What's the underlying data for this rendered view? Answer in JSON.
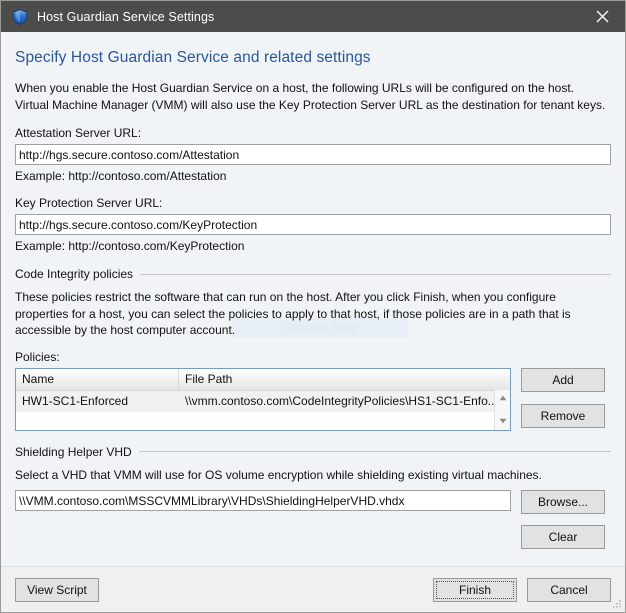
{
  "window": {
    "title": "Host Guardian Service Settings",
    "icon": "shield-icon",
    "close_label": "✕",
    "titlebar_color": "#4c4c4a",
    "body_color": "#f0f4f7",
    "accent_color": "#2b5797"
  },
  "page": {
    "heading": "Specify Host Guardian Service and related settings",
    "intro_line1": "When you enable the Host Guardian Service on a host, the following URLs will be configured on the host.",
    "intro_line2": "Virtual Machine Manager (VMM) will also use the Key Protection Server URL as the destination for tenant keys."
  },
  "attestation": {
    "label": "Attestation Server URL:",
    "value": "http://hgs.secure.contoso.com/Attestation",
    "placeholder": "",
    "example": "Example: http://contoso.com/Attestation"
  },
  "key_protection": {
    "label": "Key Protection Server URL:",
    "value": "http://hgs.secure.contoso.com/KeyProtection",
    "placeholder": "",
    "example": "Example: http://contoso.com/KeyProtection"
  },
  "code_integrity": {
    "group_label": "Code Integrity policies",
    "desc_line1": "These policies restrict the software that can run on the host. After you click Finish, when you configure",
    "desc_line2": "properties for a host, you can select the policies to apply to that host, if those policies are in a path that is",
    "desc_line3": "accessible by the host computer account.",
    "policies_label": "Policies:",
    "columns": [
      "Name",
      "File Path"
    ],
    "rows": [
      {
        "name": "HW1-SC1-Enforced",
        "file_path": "\\\\vmm.contoso.com\\CodeIntegrityPolicies\\HS1-SC1-Enfo..."
      }
    ],
    "add_label": "Add",
    "remove_label": "Remove"
  },
  "shielding": {
    "group_label": "Shielding Helper VHD",
    "desc": "Select a VHD that VMM will use for OS volume encryption while shielding existing virtual machines.",
    "value": "\\\\VMM.contoso.com\\MSSCVMMLibrary\\VHDs\\ShieldingHelperVHD.vhdx",
    "placeholder": "",
    "browse_label": "Browse...",
    "clear_label": "Clear"
  },
  "footer": {
    "view_script_label": "View Script",
    "finish_label": "Finish",
    "cancel_label": "Cancel"
  },
  "artifact": {
    "watermark_text": "Window Snip"
  }
}
